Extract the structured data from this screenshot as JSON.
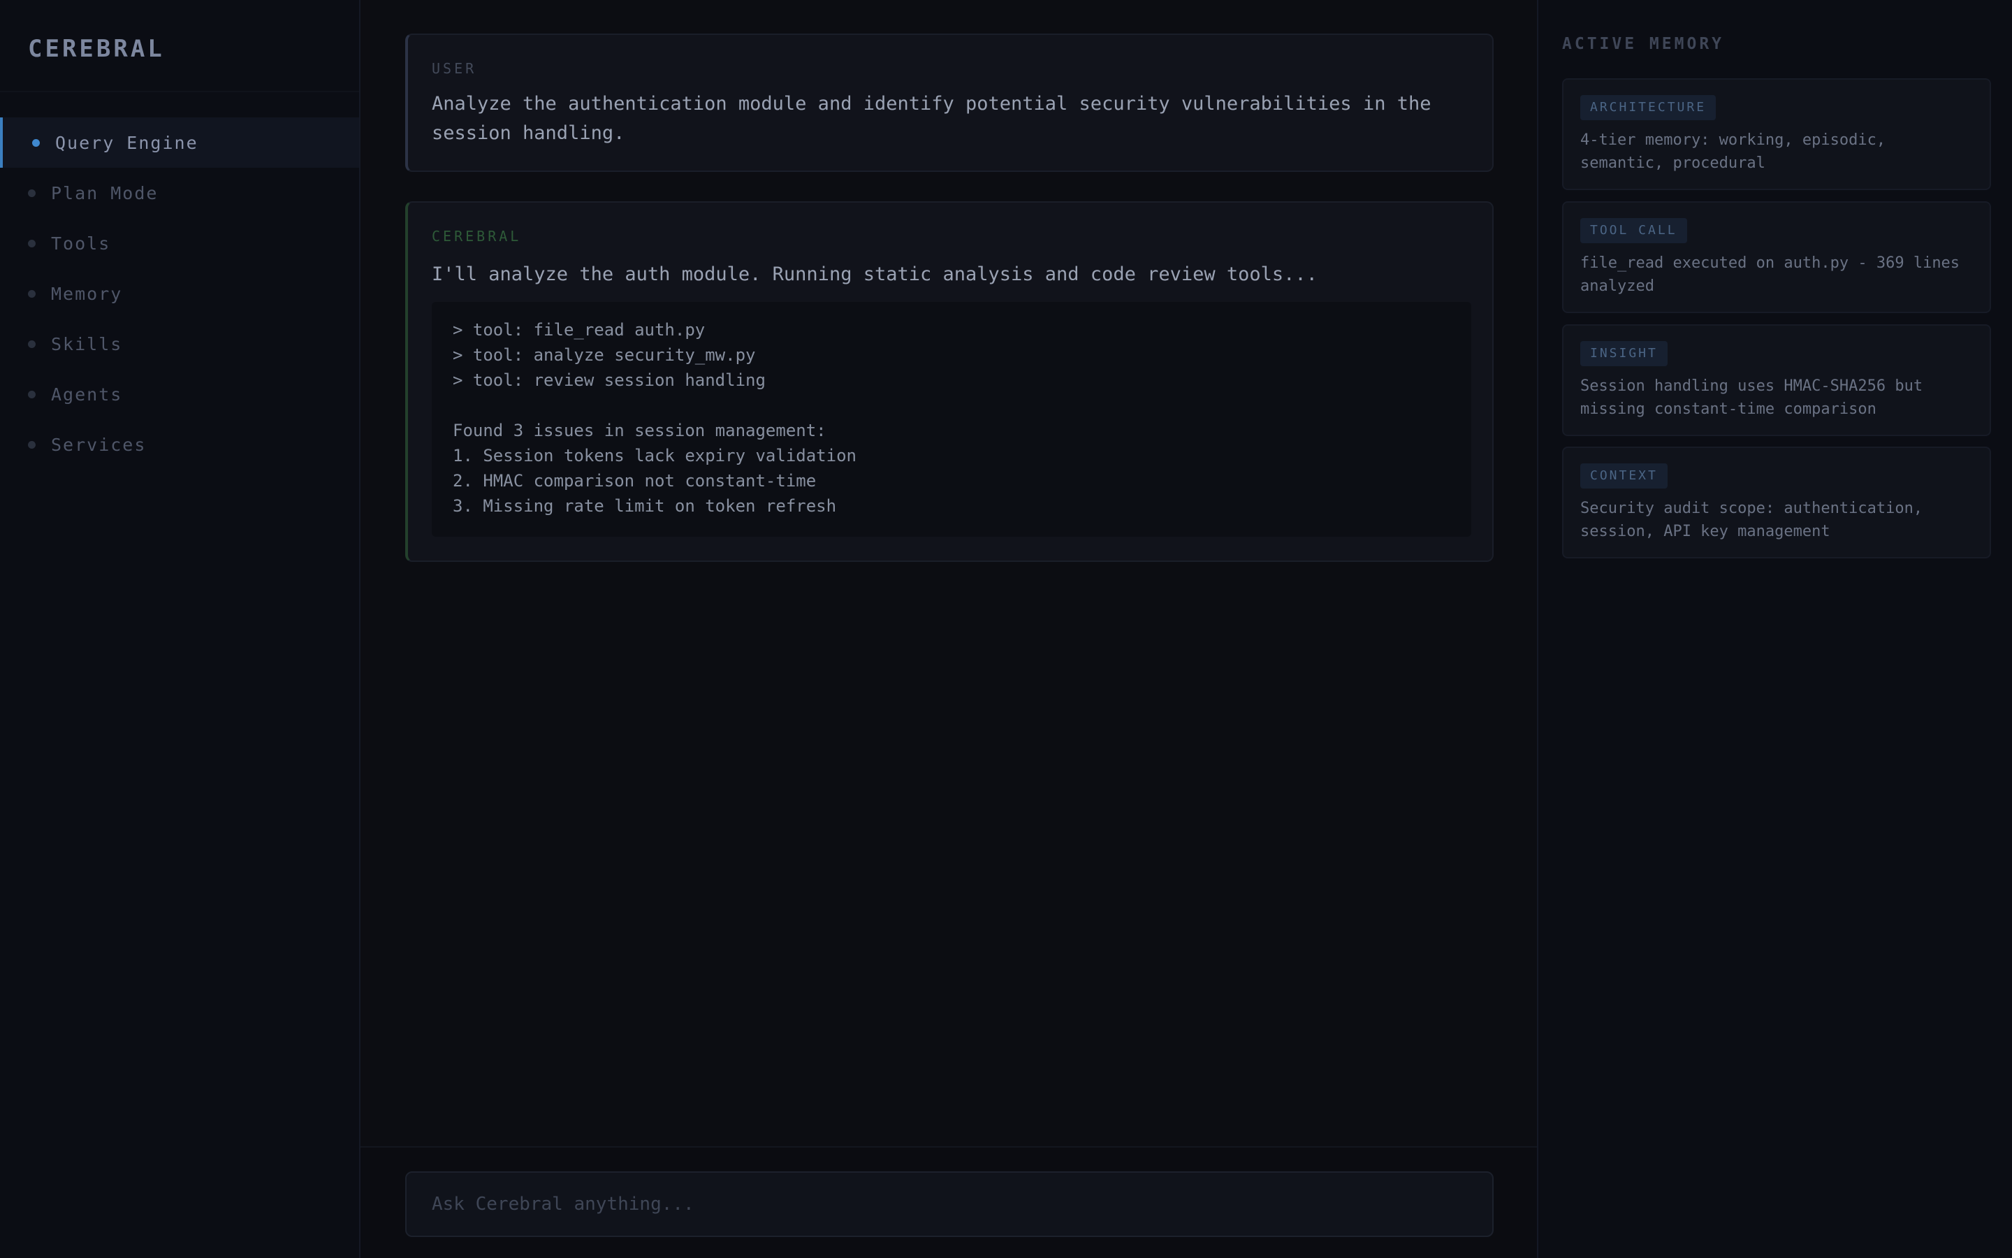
{
  "app": {
    "brand": "CEREBRAL"
  },
  "sidebar": {
    "items": [
      {
        "label": "Query Engine",
        "active": true
      },
      {
        "label": "Plan Mode",
        "active": false
      },
      {
        "label": "Tools",
        "active": false
      },
      {
        "label": "Memory",
        "active": false
      },
      {
        "label": "Skills",
        "active": false
      },
      {
        "label": "Agents",
        "active": false
      },
      {
        "label": "Services",
        "active": false
      }
    ]
  },
  "conversation": {
    "user": {
      "role": "USER",
      "text": "Analyze the authentication module and identify potential security vulnerabilities in the\nsession handling."
    },
    "assistant": {
      "role": "CEREBRAL",
      "text": "I'll analyze the auth module. Running static analysis and code review tools...",
      "code": "> tool: file_read auth.py\n> tool: analyze security_mw.py\n> tool: review session handling\n\nFound 3 issues in session management:\n1. Session tokens lack expiry validation\n2. HMAC comparison not constant-time\n3. Missing rate limit on token refresh"
    }
  },
  "input": {
    "placeholder": "Ask Cerebral anything..."
  },
  "memory": {
    "title": "ACTIVE MEMORY",
    "cards": [
      {
        "tag": "ARCHITECTURE",
        "text": "4-tier memory: working, episodic, semantic, procedural"
      },
      {
        "tag": "TOOL CALL",
        "text": "file_read executed on auth.py - 369 lines analyzed"
      },
      {
        "tag": "INSIGHT",
        "text": "Session handling uses HMAC-SHA256 but missing constant-time comparison"
      },
      {
        "tag": "CONTEXT",
        "text": "Security audit scope: authentication, session, API key management"
      }
    ]
  },
  "colors": {
    "accent": "#3f88cf",
    "assistant": "#2e5a38"
  }
}
